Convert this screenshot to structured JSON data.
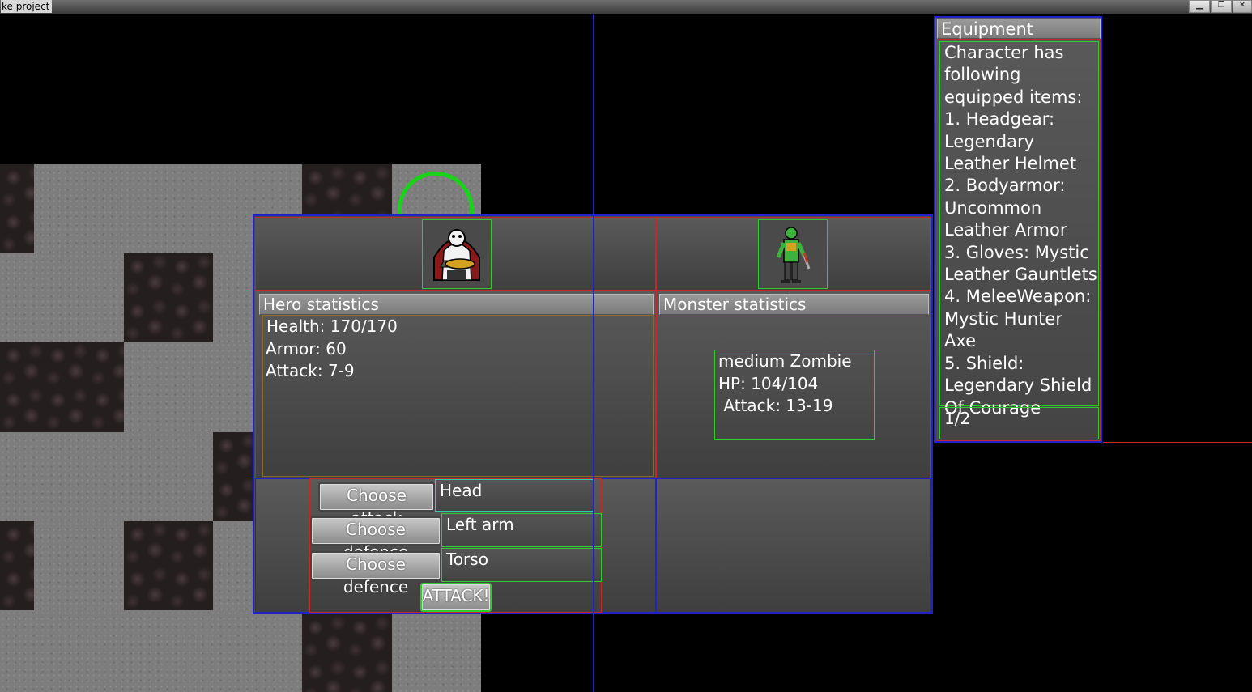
{
  "window": {
    "title": "ke project",
    "minimize": "▁",
    "maximize": "❐",
    "close": "✕"
  },
  "battle": {
    "hero_portrait": "hero-icon",
    "monster_portrait": "zombie-icon",
    "hero_stats": {
      "header": "Hero statistics",
      "health": "Health: 170/170",
      "armor": "Armor: 60",
      "attack": "Attack: 7-9"
    },
    "monster_stats": {
      "header": "Monster statistics",
      "name": "medium Zombie",
      "hp": "HP: 104/104",
      "attack": " Attack: 13-19"
    },
    "controls": {
      "choose_attack_label": "Choose attack",
      "attack_target": "Head",
      "choose_defence_label_1": "Choose defence",
      "defence_target_1": "Left arm",
      "choose_defence_label_2": "Choose defence",
      "defence_target_2": "Torso",
      "attack_button": "ATTACK!"
    }
  },
  "equipment": {
    "header": "Equipment",
    "text": "Character has following equipped items:\n1. Headgear: Legendary Leather Helmet\n2. Bodyarmor: Uncommon Leather Armor\n3. Gloves: Mystic Leather Gauntlets\n4. MeleeWeapon: Mystic Hunter Axe\n5. Shield: Legendary Shield Of Courage",
    "page": "1/2"
  },
  "colors": {
    "selection_ring": "#1bd21b",
    "panel_border_blue": "#2222cc",
    "panel_border_red": "#c62828",
    "frame_green": "#2ecc2e"
  }
}
